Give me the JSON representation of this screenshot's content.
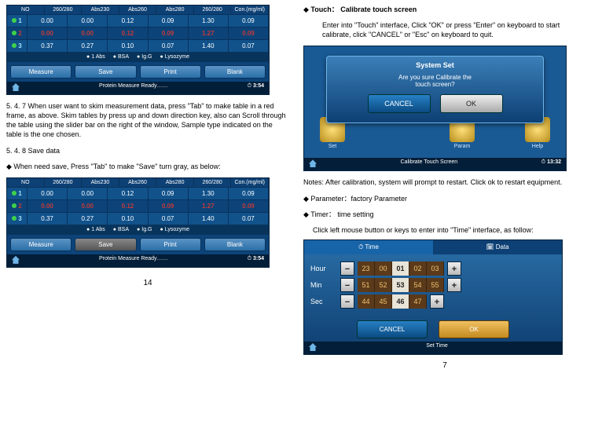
{
  "left": {
    "table_head": [
      "NO",
      "260/280",
      "Abs230",
      "Abs260",
      "Abs280",
      "260/280",
      "Con.(mg/ml)"
    ],
    "rows": [
      {
        "idx": "1",
        "c": [
          "0.00",
          "0.00",
          "0.12",
          "0.09",
          "1.30",
          "0.09"
        ]
      },
      {
        "idx": "2",
        "c": [
          "0.00",
          "0.00",
          "0.12",
          "0.09",
          "1.27",
          "0.09"
        ],
        "sel": true
      },
      {
        "idx": "3",
        "c": [
          "0.37",
          "0.27",
          "0.10",
          "0.07",
          "1.40",
          "0.07"
        ]
      }
    ],
    "legend": [
      "1 Abs",
      "BSA",
      "Ig.G",
      "Lysozyme"
    ],
    "btns": [
      "Measure",
      "Save",
      "Print",
      "Blank"
    ],
    "status_left": "Protein Measure Ready……",
    "status_time": "3:54",
    "para547": "5. 4. 7  When user want to skim measurement data, press \"Tab\" to make table in a red frame, as above. Skim tables by press up and down direction key, also can Scroll through the table using the slider bar on the right of the window, Sample type indicated on the table is the one chosen.",
    "h548": "5. 4. 8  Save data",
    "para548": "When need save, Press \"Tab\" to make \"Save\" turn gray, as below:",
    "pagenum": "14"
  },
  "right": {
    "h_touch": "Touch： Calibrate touch screen",
    "touch_para": "Enter into \"Touch\" interface, Click \"OK\" or press \"Enter\" on keyboard to start calibrate, click \"CANCEL\" or \"Esc\" on keyboard to quit.",
    "sys": {
      "title": "System Set",
      "msg1": "Are you sure Calibrate the",
      "msg2": "touch screen?",
      "cancel": "CANCEL",
      "ok": "OK",
      "bg_labels": [
        "Set",
        "Param",
        "Help"
      ],
      "status": "Calibrate Touch Screen",
      "time": "13:32"
    },
    "notes": "Notes:   After calibration, system will prompt to restart. Click ok to restart equipment.",
    "param": "Parameter：factory Parameter",
    "timer": "Timer： time setting",
    "timer_para": "Click left mouse button or keys to enter into \"Time\" interface, as follow:",
    "time_panel": {
      "tabs": [
        "Time",
        "Data"
      ],
      "rows": [
        {
          "lbl": "Hour",
          "vals": [
            "23",
            "00",
            "01",
            "02",
            "03"
          ],
          "cur": 2
        },
        {
          "lbl": "Min",
          "vals": [
            "51",
            "52",
            "53",
            "54",
            "55"
          ],
          "cur": 2
        },
        {
          "lbl": "Sec",
          "vals": [
            "44",
            "45",
            "46",
            "47"
          ],
          "cur": 2
        }
      ],
      "cancel": "CANCEL",
      "ok": "OK",
      "status": "Set Time"
    },
    "pagenum": "7"
  }
}
